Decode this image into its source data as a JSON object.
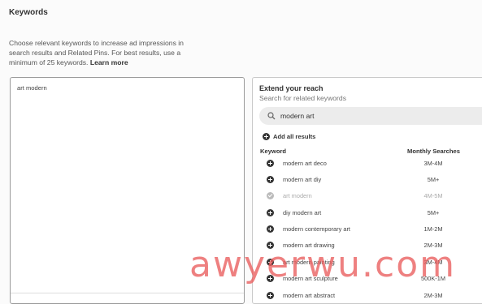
{
  "section": {
    "title": "Keywords",
    "description": "Choose relevant keywords to increase ad impressions in search results and Related Pins. For best results, use a minimum of 25 keywords.",
    "learn_more": "Learn more"
  },
  "selected_keywords": {
    "entries": [
      "art modern"
    ]
  },
  "extend": {
    "title": "Extend your reach",
    "subtitle": "Search for related keywords",
    "search_value": "modern art",
    "add_all_label": "Add all results",
    "col_keyword": "Keyword",
    "col_monthly": "Monthly Searches",
    "rows": [
      {
        "keyword": "modern art deco",
        "searches": "3M-4M",
        "state": "add"
      },
      {
        "keyword": "modern art diy",
        "searches": "5M+",
        "state": "add"
      },
      {
        "keyword": "art modern",
        "searches": "4M-5M",
        "state": "added"
      },
      {
        "keyword": "diy modern art",
        "searches": "5M+",
        "state": "add"
      },
      {
        "keyword": "modern contemporary art",
        "searches": "1M-2M",
        "state": "add"
      },
      {
        "keyword": "modern art drawing",
        "searches": "2M-3M",
        "state": "add"
      },
      {
        "keyword": "art modern painting",
        "searches": "3M-4M",
        "state": "add"
      },
      {
        "keyword": "modern art sculpture",
        "searches": "500K-1M",
        "state": "add"
      },
      {
        "keyword": "modern art abstract",
        "searches": "2M-3M",
        "state": "add"
      }
    ]
  },
  "watermark": "awyerwu.com"
}
